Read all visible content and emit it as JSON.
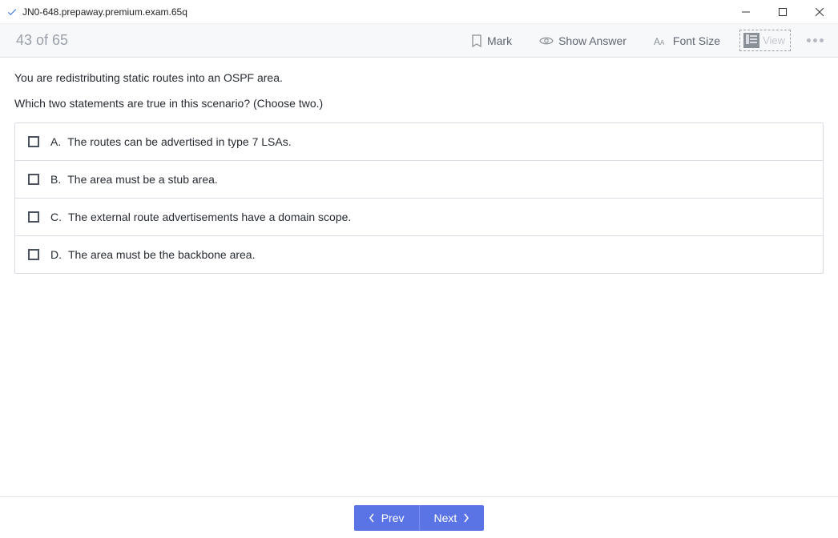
{
  "window": {
    "title": "JN0-648.prepaway.premium.exam.65q"
  },
  "toolbar": {
    "progress": "43 of 65",
    "mark_label": "Mark",
    "show_answer_label": "Show Answer",
    "font_size_label": "Font Size",
    "view_label": "View"
  },
  "question": {
    "line1": "You are redistributing static routes into an OSPF area.",
    "line2": "Which two statements are true in this scenario? (Choose two.)",
    "answers": [
      {
        "letter": "A.",
        "text": "The routes can be advertised in type 7 LSAs."
      },
      {
        "letter": "B.",
        "text": "The area must be a stub area."
      },
      {
        "letter": "C.",
        "text": "The external route advertisements have a domain scope."
      },
      {
        "letter": "D.",
        "text": "The area must be the backbone area."
      }
    ]
  },
  "footer": {
    "prev_label": "Prev",
    "next_label": "Next"
  }
}
